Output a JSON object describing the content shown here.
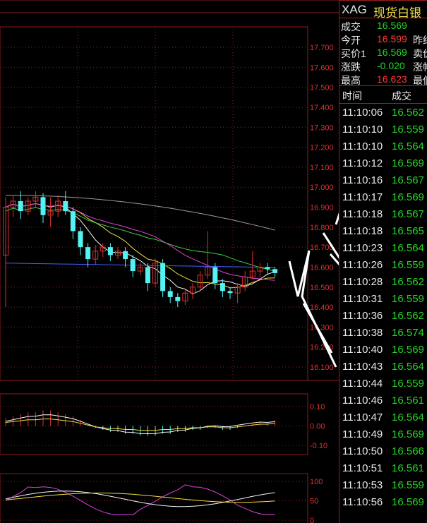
{
  "header": {
    "code": "XAG",
    "name": "现货白银"
  },
  "quote": [
    {
      "label": "成交",
      "value": "16.569",
      "color": "#26d626",
      "label2": ""
    },
    {
      "label": "今开",
      "value": "16.599",
      "color": "#ff3b3b",
      "label2": "昨结"
    },
    {
      "label": "买价1",
      "value": "16.569",
      "color": "#26d626",
      "label2": "卖价"
    },
    {
      "label": "涨跌",
      "value": "-0.020",
      "color": "#26d626",
      "label2": "涨幅"
    },
    {
      "label": "最高",
      "value": "16.623",
      "color": "#ff3b3b",
      "label2": "最低"
    }
  ],
  "ticks_header": {
    "time": "时间",
    "price": "成交"
  },
  "ticks": [
    {
      "time": "11:10:06",
      "price": "16.562"
    },
    {
      "time": "11:10:10",
      "price": "16.559"
    },
    {
      "time": "11:10:10",
      "price": "16.564"
    },
    {
      "time": "11:10:12",
      "price": "16.569"
    },
    {
      "time": "11:10:16",
      "price": "16.567"
    },
    {
      "time": "11:10:17",
      "price": "16.569"
    },
    {
      "time": "11:10:18",
      "price": "16.567"
    },
    {
      "time": "11:10:18",
      "price": "16.565"
    },
    {
      "time": "11:10:23",
      "price": "16.564"
    },
    {
      "time": "11:10:26",
      "price": "16.559"
    },
    {
      "time": "11:10:28",
      "price": "16.562"
    },
    {
      "time": "11:10:31",
      "price": "16.559"
    },
    {
      "time": "11:10:36",
      "price": "16.562"
    },
    {
      "time": "11:10:38",
      "price": "16.574"
    },
    {
      "time": "11:10:40",
      "price": "16.569"
    },
    {
      "time": "11:10:43",
      "price": "16.564"
    },
    {
      "time": "11:10:44",
      "price": "16.559"
    },
    {
      "time": "11:10:46",
      "price": "16.561"
    },
    {
      "time": "11:10:47",
      "price": "16.564"
    },
    {
      "time": "11:10:49",
      "price": "16.569"
    },
    {
      "time": "11:10:50",
      "price": "16.566"
    },
    {
      "time": "11:10:51",
      "price": "16.561"
    },
    {
      "time": "11:10:53",
      "price": "16.559"
    },
    {
      "time": "11:10:56",
      "price": "16.569"
    }
  ],
  "chart_data": {
    "type": "candlestick",
    "price_axis": {
      "ticks": [
        "17.700",
        "17.600",
        "17.500",
        "17.400",
        "17.300",
        "17.200",
        "17.100",
        "17.000",
        "16.900",
        "16.800",
        "16.700",
        "16.600",
        "16.500",
        "16.400",
        "16.300",
        "16.200",
        "16.100"
      ],
      "ylim": [
        16.08,
        17.75
      ]
    },
    "candles": [
      [
        16.66,
        16.9,
        16.95,
        16.4
      ],
      [
        16.9,
        16.93,
        16.96,
        16.85
      ],
      [
        16.93,
        16.88,
        16.98,
        16.84
      ],
      [
        16.88,
        16.93,
        16.95,
        16.86
      ],
      [
        16.93,
        16.95,
        16.98,
        16.9
      ],
      [
        16.95,
        16.86,
        16.97,
        16.82
      ],
      [
        16.86,
        16.88,
        16.95,
        16.8
      ],
      [
        16.88,
        16.93,
        16.96,
        16.85
      ],
      [
        16.93,
        16.88,
        16.98,
        16.86
      ],
      [
        16.88,
        16.78,
        16.9,
        16.74
      ],
      [
        16.78,
        16.7,
        16.8,
        16.66
      ],
      [
        16.7,
        16.64,
        16.72,
        16.6
      ],
      [
        16.64,
        16.68,
        16.71,
        16.61
      ],
      [
        16.68,
        16.7,
        16.72,
        16.65
      ],
      [
        16.7,
        16.66,
        16.72,
        16.63
      ],
      [
        16.66,
        16.68,
        16.7,
        16.64
      ],
      [
        16.68,
        16.64,
        16.7,
        16.6
      ],
      [
        16.64,
        16.58,
        16.66,
        16.55
      ],
      [
        16.58,
        16.6,
        16.62,
        16.56
      ],
      [
        16.6,
        16.52,
        16.62,
        16.48
      ],
      [
        16.52,
        16.62,
        16.64,
        16.5
      ],
      [
        16.62,
        16.48,
        16.64,
        16.45
      ],
      [
        16.48,
        16.45,
        16.5,
        16.42
      ],
      [
        16.45,
        16.43,
        16.47,
        16.4
      ],
      [
        16.43,
        16.47,
        16.49,
        16.41
      ],
      [
        16.47,
        16.5,
        16.52,
        16.44
      ],
      [
        16.5,
        16.56,
        16.58,
        16.48
      ],
      [
        16.56,
        16.6,
        16.78,
        16.54
      ],
      [
        16.6,
        16.52,
        16.62,
        16.49
      ],
      [
        16.52,
        16.48,
        16.54,
        16.45
      ],
      [
        16.48,
        16.47,
        16.5,
        16.44
      ],
      [
        16.47,
        16.5,
        16.52,
        16.42
      ],
      [
        16.5,
        16.55,
        16.58,
        16.48
      ],
      [
        16.55,
        16.58,
        16.68,
        16.54
      ],
      [
        16.58,
        16.6,
        16.62,
        16.55
      ],
      [
        16.6,
        16.59,
        16.62,
        16.56
      ],
      [
        16.59,
        16.57,
        16.6,
        16.55
      ]
    ],
    "macd_axis": {
      "ticks": [
        "0.10",
        "0.00",
        "-0.10"
      ],
      "ylim": [
        -0.15,
        0.15
      ]
    },
    "macd_hist": [
      0.04,
      0.05,
      0.06,
      0.07,
      0.07,
      0.08,
      0.08,
      0.07,
      0.06,
      0.05,
      0.03,
      0.01,
      -0.01,
      -0.02,
      -0.03,
      -0.03,
      -0.04,
      -0.04,
      -0.05,
      -0.05,
      -0.05,
      -0.04,
      -0.04,
      -0.03,
      -0.03,
      -0.02,
      -0.02,
      -0.01,
      -0.01,
      -0.02,
      -0.02,
      -0.01,
      0.0,
      0.01,
      0.02,
      0.02,
      0.03
    ],
    "kdj_axis": {
      "ticks": [
        "100",
        "50",
        "0"
      ],
      "ylim": [
        0,
        100
      ]
    }
  },
  "colors": {
    "up": "#e03030",
    "down": "#54f3f3",
    "grid": "#8e1c1c",
    "axis_text": "#e03030",
    "price_green": "#26d626",
    "price_red": "#ff3b3b"
  }
}
